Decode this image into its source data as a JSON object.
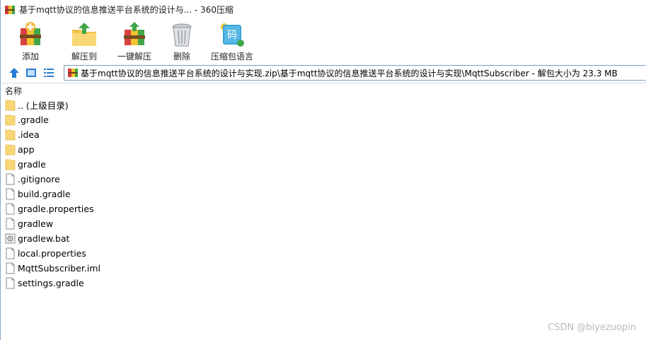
{
  "window": {
    "title": "基于mqtt协议的信息推送平台系统的设计与... - 360压缩",
    "app_icon": "archive-app-icon"
  },
  "toolbar": {
    "buttons": [
      {
        "label": "添加",
        "icon": "add-archive-icon"
      },
      {
        "label": "解压到",
        "icon": "extract-to-icon"
      },
      {
        "label": "一键解压",
        "icon": "one-click-extract-icon"
      },
      {
        "label": "删除",
        "icon": "delete-trash-icon"
      },
      {
        "label": "压缩包语言",
        "icon": "archive-language-icon",
        "glyph": "码"
      }
    ]
  },
  "navbar": {
    "up_icon": "up-arrow-icon",
    "view_icon": "thumbnail-view-icon",
    "list_icon": "list-view-icon",
    "address": "基于mqtt协议的信息推送平台系统的设计与实现.zip\\基于mqtt协议的信息推送平台系统的设计与实现\\MqttSubscriber - 解包大小为 23.3 MB"
  },
  "list": {
    "column_name": "名称",
    "items": [
      {
        "name": ".. (上级目录)",
        "type": "folder"
      },
      {
        "name": ".gradle",
        "type": "folder"
      },
      {
        "name": ".idea",
        "type": "folder"
      },
      {
        "name": "app",
        "type": "folder"
      },
      {
        "name": "gradle",
        "type": "folder"
      },
      {
        "name": ".gitignore",
        "type": "file"
      },
      {
        "name": "build.gradle",
        "type": "file"
      },
      {
        "name": "gradle.properties",
        "type": "file"
      },
      {
        "name": "gradlew",
        "type": "file"
      },
      {
        "name": "gradlew.bat",
        "type": "bat"
      },
      {
        "name": "local.properties",
        "type": "file"
      },
      {
        "name": "MqttSubscriber.iml",
        "type": "file"
      },
      {
        "name": "settings.gradle",
        "type": "file"
      }
    ]
  },
  "watermark": "CSDN @biyezuopin",
  "colors": {
    "folder": "#f9d776",
    "folder_edge": "#e0b64a",
    "border": "#7f9db9",
    "accent_blue": "#2b7bd8"
  }
}
